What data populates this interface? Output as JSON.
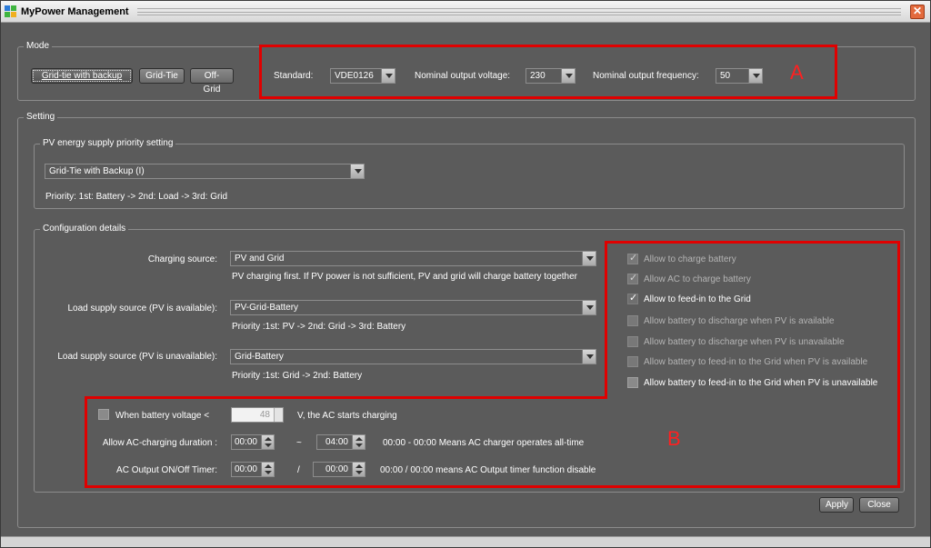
{
  "window": {
    "title": "MyPower Management",
    "close_glyph": "✕"
  },
  "mode": {
    "legend": "Mode",
    "buttons": {
      "grid_tie_backup": "Grid-tie with backup",
      "grid_tie": "Grid-Tie",
      "off_grid": "Off-Grid"
    },
    "standard_label": "Standard:",
    "standard_value": "VDE0126",
    "voltage_label": "Nominal output voltage:",
    "voltage_value": "230",
    "frequency_label": "Nominal output frequency:",
    "frequency_value": "50",
    "annotation": "A"
  },
  "setting": {
    "legend": "Setting",
    "pv_priority": {
      "legend": "PV energy supply priority setting",
      "selected": "Grid-Tie with Backup (I)",
      "priority_text": "Priority: 1st: Battery -> 2nd: Load -> 3rd: Grid"
    },
    "config": {
      "legend": "Configuration details",
      "charging_source_label": "Charging source:",
      "charging_source_value": "PV and Grid",
      "charging_source_desc": "PV charging first. If PV power is not sufficient, PV and grid will charge battery together",
      "load_pv_avail_label": "Load supply source (PV is available):",
      "load_pv_avail_value": "PV-Grid-Battery",
      "load_pv_avail_desc": "Priority :1st: PV -> 2nd: Grid -> 3rd: Battery",
      "load_pv_unavail_label": "Load supply source (PV is unavailable):",
      "load_pv_unavail_value": "Grid-Battery",
      "load_pv_unavail_desc": "Priority :1st: Grid -> 2nd: Battery",
      "options": [
        "Allow to charge battery",
        "Allow AC to charge battery",
        "Allow to feed-in to the Grid",
        "Allow battery to discharge when PV is available",
        "Allow battery to discharge when PV is unavailable",
        "Allow battery to feed-in to the Grid when PV is available",
        "Allow battery to feed-in to the Grid when PV is unavailable"
      ],
      "battery_voltage_label": "When battery voltage <",
      "battery_voltage_value": "48",
      "battery_voltage_suffix": "V,   the AC starts charging",
      "ac_duration_label": "Allow AC-charging duration :",
      "ac_duration_start": "00:00",
      "ac_duration_sep": "~",
      "ac_duration_end": "04:00",
      "ac_duration_note": "00:00 - 00:00 Means AC charger operates all-time",
      "ac_timer_label": "AC Output ON/Off Timer:",
      "ac_timer_start": "00:00",
      "ac_timer_sep": "/",
      "ac_timer_end": "00:00",
      "ac_timer_note": "00:00 / 00:00 means AC Output timer function disable",
      "annotation": "B"
    }
  },
  "footer": {
    "apply": "Apply",
    "close": "Close"
  },
  "colors": {
    "window_bg": "#5b5b5b",
    "annotation_red": "#e00000"
  }
}
